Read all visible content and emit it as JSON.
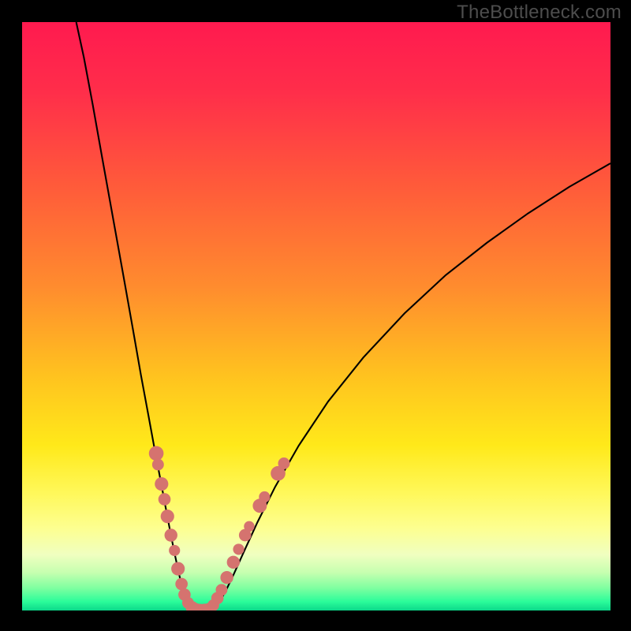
{
  "watermark": "TheBottleneck.com",
  "chart_data": {
    "type": "line",
    "title": "",
    "xlabel": "",
    "ylabel": "",
    "xlim": [
      0,
      100
    ],
    "ylim": [
      0,
      100
    ],
    "background_gradient": {
      "orientation": "vertical",
      "stops": [
        {
          "offset": 0.0,
          "color": "#ff1a4f"
        },
        {
          "offset": 0.12,
          "color": "#ff2e4a"
        },
        {
          "offset": 0.28,
          "color": "#ff5b3a"
        },
        {
          "offset": 0.45,
          "color": "#ff8c2e"
        },
        {
          "offset": 0.6,
          "color": "#ffc21f"
        },
        {
          "offset": 0.72,
          "color": "#ffe91a"
        },
        {
          "offset": 0.8,
          "color": "#fff85a"
        },
        {
          "offset": 0.86,
          "color": "#fdff90"
        },
        {
          "offset": 0.905,
          "color": "#f0ffc0"
        },
        {
          "offset": 0.935,
          "color": "#c7ffb0"
        },
        {
          "offset": 0.962,
          "color": "#7effa0"
        },
        {
          "offset": 0.985,
          "color": "#2bfc9a"
        },
        {
          "offset": 1.0,
          "color": "#0bd88a"
        }
      ]
    },
    "series": [
      {
        "name": "left-curve",
        "stroke": "#000000",
        "stroke_width": 2.1,
        "points": [
          {
            "x": 9.2,
            "y": 100.0
          },
          {
            "x": 10.5,
            "y": 94.0
          },
          {
            "x": 12.0,
            "y": 86.0
          },
          {
            "x": 13.6,
            "y": 77.0
          },
          {
            "x": 15.4,
            "y": 67.0
          },
          {
            "x": 17.2,
            "y": 57.0
          },
          {
            "x": 18.8,
            "y": 48.0
          },
          {
            "x": 20.2,
            "y": 40.0
          },
          {
            "x": 21.5,
            "y": 33.0
          },
          {
            "x": 22.6,
            "y": 27.0
          },
          {
            "x": 23.6,
            "y": 21.8
          },
          {
            "x": 24.4,
            "y": 17.5
          },
          {
            "x": 25.2,
            "y": 13.3
          },
          {
            "x": 25.9,
            "y": 9.8
          },
          {
            "x": 26.6,
            "y": 6.5
          },
          {
            "x": 27.2,
            "y": 4.0
          },
          {
            "x": 27.8,
            "y": 2.2
          },
          {
            "x": 28.4,
            "y": 1.0
          },
          {
            "x": 29.1,
            "y": 0.3
          },
          {
            "x": 29.8,
            "y": 0.0
          }
        ]
      },
      {
        "name": "right-curve",
        "stroke": "#000000",
        "stroke_width": 2.1,
        "points": [
          {
            "x": 31.8,
            "y": 0.0
          },
          {
            "x": 32.6,
            "y": 0.4
          },
          {
            "x": 33.5,
            "y": 1.4
          },
          {
            "x": 34.6,
            "y": 3.3
          },
          {
            "x": 35.9,
            "y": 6.0
          },
          {
            "x": 37.7,
            "y": 10.0
          },
          {
            "x": 40.0,
            "y": 15.0
          },
          {
            "x": 43.0,
            "y": 21.0
          },
          {
            "x": 47.0,
            "y": 28.0
          },
          {
            "x": 52.0,
            "y": 35.5
          },
          {
            "x": 58.0,
            "y": 43.0
          },
          {
            "x": 65.0,
            "y": 50.5
          },
          {
            "x": 72.0,
            "y": 57.0
          },
          {
            "x": 79.0,
            "y": 62.5
          },
          {
            "x": 86.0,
            "y": 67.5
          },
          {
            "x": 93.0,
            "y": 72.0
          },
          {
            "x": 100.0,
            "y": 76.0
          }
        ]
      }
    ],
    "markers": {
      "name": "sample-dots",
      "fill": "#d5736f",
      "left_group": [
        {
          "x": 22.8,
          "y": 26.7,
          "r": 1.25
        },
        {
          "x": 23.1,
          "y": 24.8,
          "r": 1.0
        },
        {
          "x": 23.7,
          "y": 21.5,
          "r": 1.15
        },
        {
          "x": 24.2,
          "y": 18.9,
          "r": 1.05
        },
        {
          "x": 24.7,
          "y": 16.0,
          "r": 1.15
        },
        {
          "x": 25.3,
          "y": 12.8,
          "r": 1.1
        },
        {
          "x": 25.9,
          "y": 10.2,
          "r": 0.95
        },
        {
          "x": 26.5,
          "y": 7.1,
          "r": 1.15
        },
        {
          "x": 27.1,
          "y": 4.5,
          "r": 1.05
        },
        {
          "x": 27.6,
          "y": 2.7,
          "r": 1.05
        },
        {
          "x": 28.2,
          "y": 1.3,
          "r": 1.0
        },
        {
          "x": 28.9,
          "y": 0.5,
          "r": 1.1
        }
      ],
      "bottom_group": [
        {
          "x": 29.6,
          "y": 0.12,
          "r": 1.1
        },
        {
          "x": 30.3,
          "y": 0.08,
          "r": 1.05
        },
        {
          "x": 31.0,
          "y": 0.1,
          "r": 1.05
        },
        {
          "x": 31.7,
          "y": 0.15,
          "r": 1.1
        }
      ],
      "right_group": [
        {
          "x": 32.5,
          "y": 0.9,
          "r": 1.0
        },
        {
          "x": 33.2,
          "y": 2.1,
          "r": 1.05
        },
        {
          "x": 33.9,
          "y": 3.5,
          "r": 1.0
        },
        {
          "x": 34.8,
          "y": 5.6,
          "r": 1.1
        },
        {
          "x": 35.9,
          "y": 8.2,
          "r": 1.1
        },
        {
          "x": 36.8,
          "y": 10.4,
          "r": 0.95
        },
        {
          "x": 37.9,
          "y": 12.8,
          "r": 1.05
        },
        {
          "x": 38.6,
          "y": 14.3,
          "r": 0.9
        },
        {
          "x": 40.4,
          "y": 17.8,
          "r": 1.2
        },
        {
          "x": 41.2,
          "y": 19.3,
          "r": 0.95
        },
        {
          "x": 43.5,
          "y": 23.3,
          "r": 1.25
        },
        {
          "x": 44.5,
          "y": 25.0,
          "r": 1.0
        }
      ]
    }
  }
}
